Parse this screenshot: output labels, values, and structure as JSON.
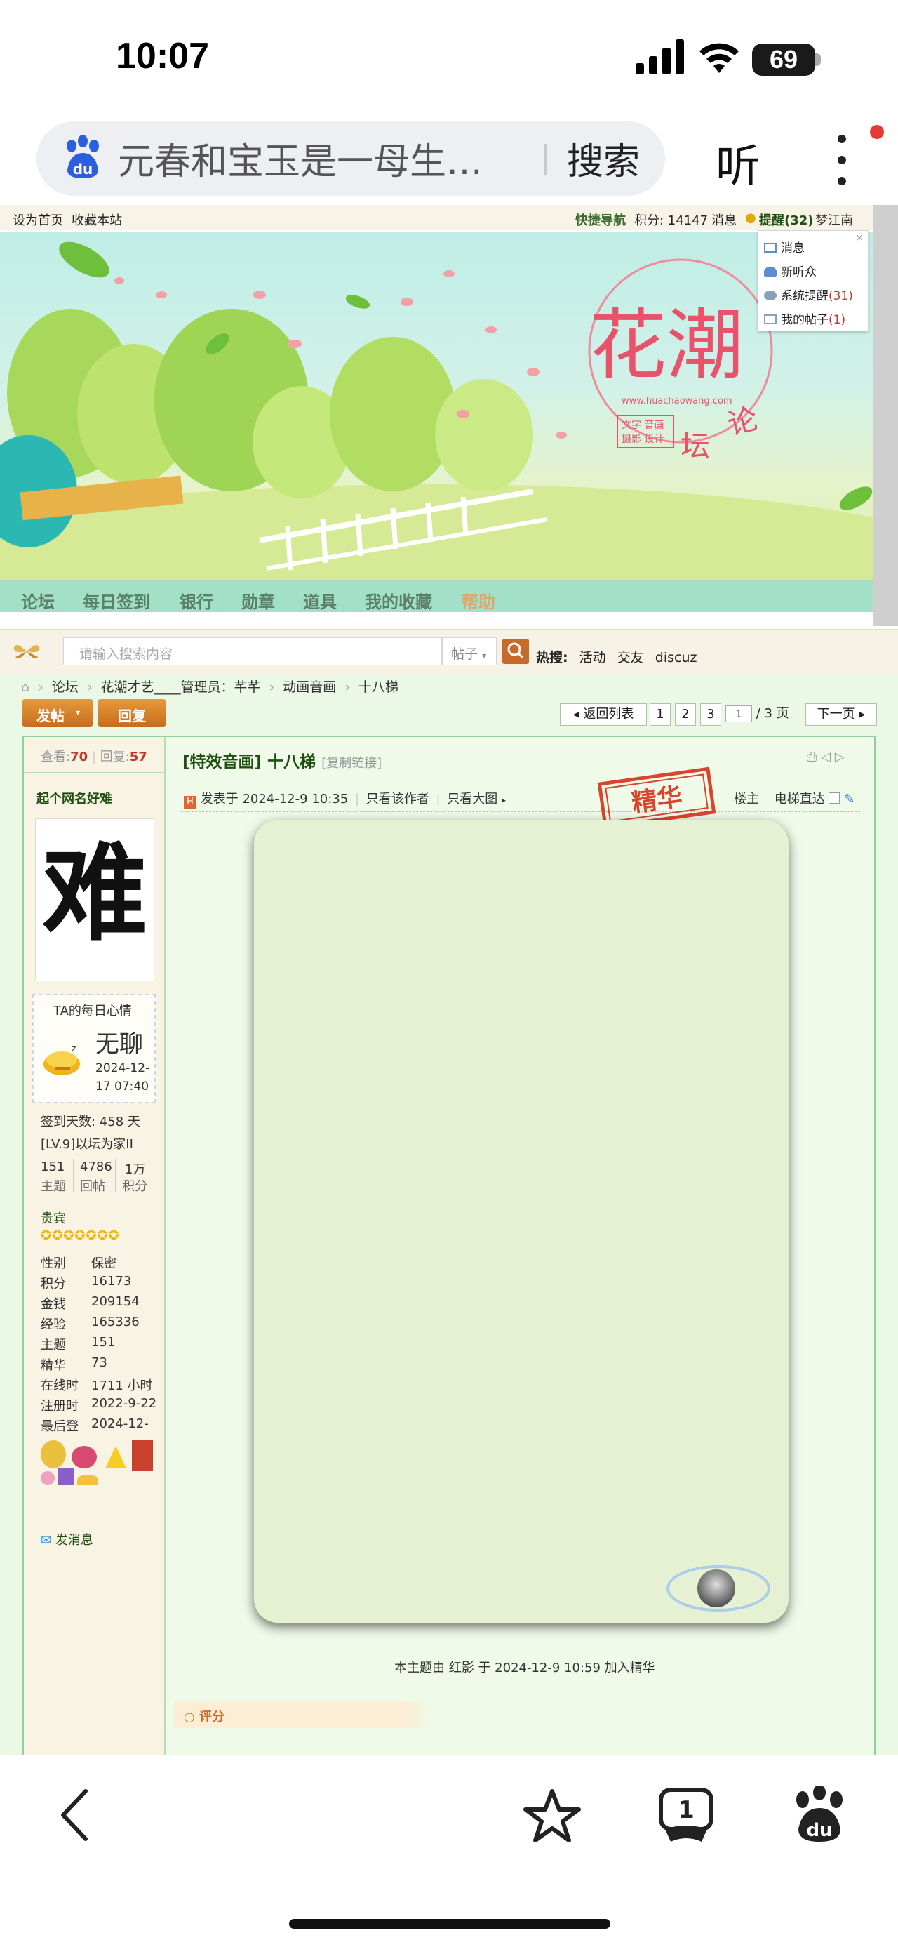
{
  "status": {
    "time": "10:07",
    "battery": "69"
  },
  "browser": {
    "query": "元春和宝玉是一母生…",
    "search_label": "搜索",
    "listen_label": "听"
  },
  "topbar": {
    "set_home": "设为首页",
    "bookmark": "收藏本站",
    "quick_nav": "快捷导航",
    "points": "积分: 14147",
    "messages": "消息",
    "remind": "提醒(32)",
    "username": "梦江南"
  },
  "notify_menu": [
    {
      "label": "消息",
      "count": ""
    },
    {
      "label": "新听众",
      "count": ""
    },
    {
      "label": "系统提醒",
      "count": "(31)"
    },
    {
      "label": "我的帖子",
      "count": "(1)"
    }
  ],
  "banner": {
    "logo_text": "花潮",
    "logo_sub": "论坛",
    "logo_url": "www.huachaowang.com",
    "tag1": "文字 音画",
    "tag2": "摄影 设计"
  },
  "nav": [
    "论坛",
    "每日签到",
    "银行",
    "勋章",
    "道具",
    "我的收藏",
    "帮助"
  ],
  "search": {
    "placeholder": "请输入搜索内容",
    "type": "帖子",
    "hot_label": "热搜:",
    "hot_items": [
      "活动",
      "交友",
      "discuz"
    ]
  },
  "breadcrumb": [
    "论坛",
    "花潮才艺____管理员：芊芊",
    "动画音画",
    "十八梯"
  ],
  "actions": {
    "post": "发帖",
    "reply": "回复"
  },
  "pager": {
    "back": "返回列表",
    "pages": [
      "1",
      "2",
      "3"
    ],
    "current": "1",
    "total": "/ 3 页",
    "next": "下一页"
  },
  "post": {
    "views_label": "查看:",
    "views": "70",
    "replies_label": "回复:",
    "replies": "57",
    "category": "[特效音画]",
    "title": "十八梯",
    "copy_link": "[复制链接]",
    "posted": "发表于 2024-12-9 10:35",
    "only_author": "只看该作者",
    "big_image": "只看大图",
    "floor": "楼主",
    "elevator": "电梯直达",
    "stamp": "精华",
    "essence_note": "本主题由 红影 于 2024-12-9 10:59 加入精华",
    "rate": "评分"
  },
  "author": {
    "name": "起个网名好难",
    "avatar_char": "难",
    "mood_title": "TA的每日心情",
    "mood": "无聊",
    "mood_date1": "2024-12-",
    "mood_date2": "17 07:40",
    "sign_days": "签到天数: 458 天",
    "level": "[LV.9]以坛为家II",
    "counts": [
      {
        "value": "151",
        "label": "主题"
      },
      {
        "value": "4786",
        "label": "回帖"
      },
      {
        "value": "1万",
        "label": "积分"
      }
    ],
    "group": "贵宾",
    "stats": [
      {
        "k": "性别",
        "v": "保密"
      },
      {
        "k": "积分",
        "v": "16173"
      },
      {
        "k": "金钱",
        "v": "209154"
      },
      {
        "k": "经验",
        "v": "165336"
      },
      {
        "k": "主题",
        "v": "151"
      },
      {
        "k": "精华",
        "v": "73"
      },
      {
        "k": "在线时",
        "v": "1711 小时"
      },
      {
        "k": "注册时",
        "v": "2022-9-22"
      },
      {
        "k": "最后登",
        "v": "2024-12-"
      }
    ],
    "send_msg": "发消息"
  },
  "colors": {
    "accent": "#c66c1e",
    "green_border": "#8ecf9a",
    "link_red": "#c0392b",
    "nav_bg": "#a2e0c8"
  }
}
